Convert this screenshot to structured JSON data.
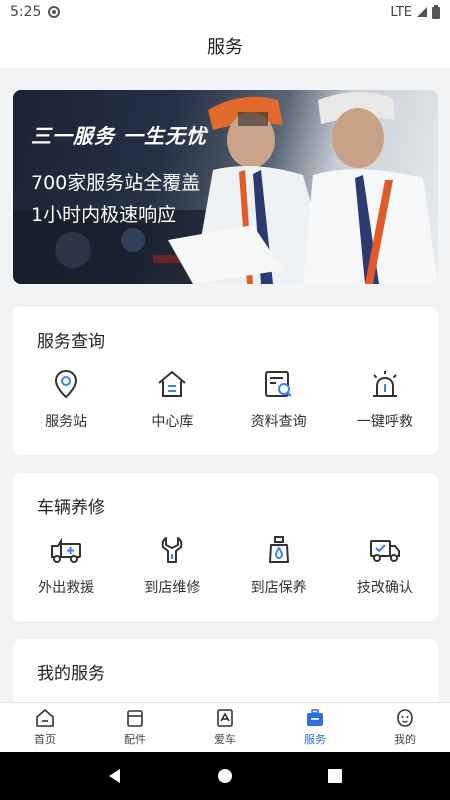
{
  "status_bar": {
    "time": "5:25",
    "network": "LTE"
  },
  "header": {
    "title": "服务"
  },
  "banner": {
    "slogan": "三一服务 一生无忧",
    "line1": "700家服务站全覆盖",
    "line2": "1小时内极速响应"
  },
  "service_query": {
    "title": "服务查询",
    "items": [
      {
        "label": "服务站",
        "icon": "location-pin-icon"
      },
      {
        "label": "中心库",
        "icon": "warehouse-icon"
      },
      {
        "label": "资料查询",
        "icon": "document-search-icon"
      },
      {
        "label": "一键呼救",
        "icon": "alarm-light-icon"
      }
    ]
  },
  "vehicle_maintenance": {
    "title": "车辆养修",
    "items": [
      {
        "label": "外出救援",
        "icon": "rescue-truck-icon"
      },
      {
        "label": "到店维修",
        "icon": "wrench-icon"
      },
      {
        "label": "到店保养",
        "icon": "oil-bottle-icon"
      },
      {
        "label": "技改确认",
        "icon": "truck-check-icon"
      }
    ]
  },
  "my_services": {
    "title": "我的服务"
  },
  "tab_bar": {
    "items": [
      {
        "label": "首页",
        "icon": "home-icon"
      },
      {
        "label": "配件",
        "icon": "parts-box-icon"
      },
      {
        "label": "爱车",
        "icon": "car-icon"
      },
      {
        "label": "服务",
        "icon": "service-bag-icon",
        "active": true
      },
      {
        "label": "我的",
        "icon": "profile-face-icon"
      }
    ],
    "active_color": "#2f6fe0"
  },
  "colors": {
    "accent": "#2f6fe0",
    "icon_blue": "#3a82f0",
    "icon_dark": "#333333"
  }
}
